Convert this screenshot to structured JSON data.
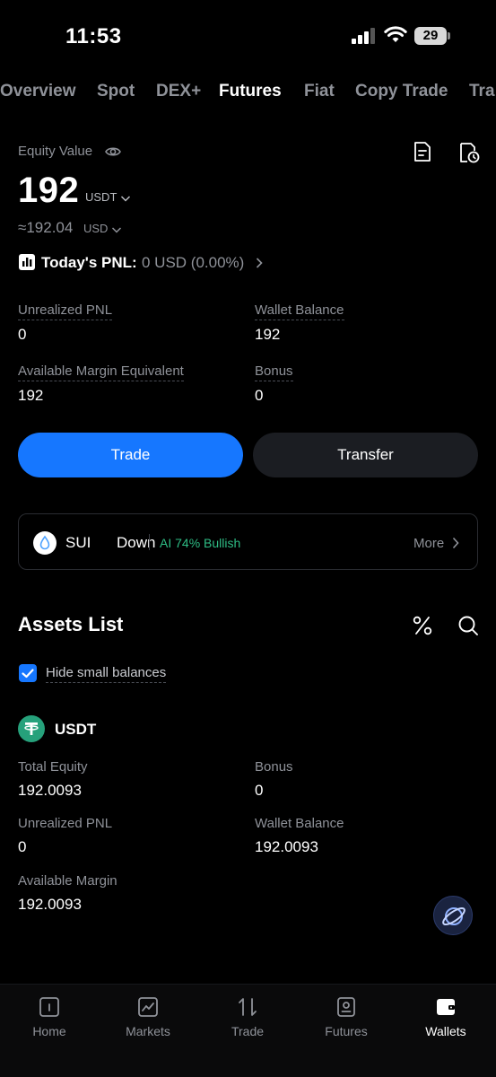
{
  "status_bar": {
    "time": "11:53",
    "battery": "29"
  },
  "tabs": [
    {
      "label": "Overview"
    },
    {
      "label": "Spot"
    },
    {
      "label": "DEX+"
    },
    {
      "label": "Futures"
    },
    {
      "label": "Fiat"
    },
    {
      "label": "Copy Trade"
    },
    {
      "label": "Tra"
    }
  ],
  "equity": {
    "label": "Equity Value",
    "value": "192",
    "unit": "USDT",
    "approx": "≈192.04",
    "approx_unit": "USD"
  },
  "pnl": {
    "label": "Today's PNL:",
    "value": "0 USD (0.00%)"
  },
  "summary": {
    "unrealized_pnl_label": "Unrealized PNL",
    "unrealized_pnl_value": "0",
    "wallet_balance_label": "Wallet Balance",
    "wallet_balance_value": "192",
    "available_margin_label": "Available Margin Equivalent",
    "available_margin_value": "192",
    "bonus_label": "Bonus",
    "bonus_value": "0"
  },
  "buttons": {
    "trade": "Trade",
    "transfer": "Transfer"
  },
  "banner": {
    "coin": "SUI",
    "direction": "Down",
    "ai_text": "AI 74% Bullish",
    "more": "More"
  },
  "assets": {
    "title": "Assets List",
    "hide_small_label": "Hide small balances",
    "hide_small_checked": true,
    "coin": "USDT",
    "total_equity_label": "Total Equity",
    "total_equity_value": "192.0093",
    "bonus_label": "Bonus",
    "bonus_value": "0",
    "unrealized_pnl_label": "Unrealized PNL",
    "unrealized_pnl_value": "0",
    "wallet_balance_label": "Wallet Balance",
    "wallet_balance_value": "192.0093",
    "available_margin_label": "Available Margin",
    "available_margin_value": "192.0093"
  },
  "nav": [
    {
      "label": "Home",
      "icon": "home-icon"
    },
    {
      "label": "Markets",
      "icon": "markets-icon"
    },
    {
      "label": "Trade",
      "icon": "trade-icon"
    },
    {
      "label": "Futures",
      "icon": "futures-icon"
    },
    {
      "label": "Wallets",
      "icon": "wallet-icon",
      "active": true
    }
  ],
  "colors": {
    "background": "#000000",
    "accent": "#1677ff",
    "positive": "#2ebd85",
    "muted_text": "#8f9299",
    "secondary_button": "#1b1d22"
  }
}
